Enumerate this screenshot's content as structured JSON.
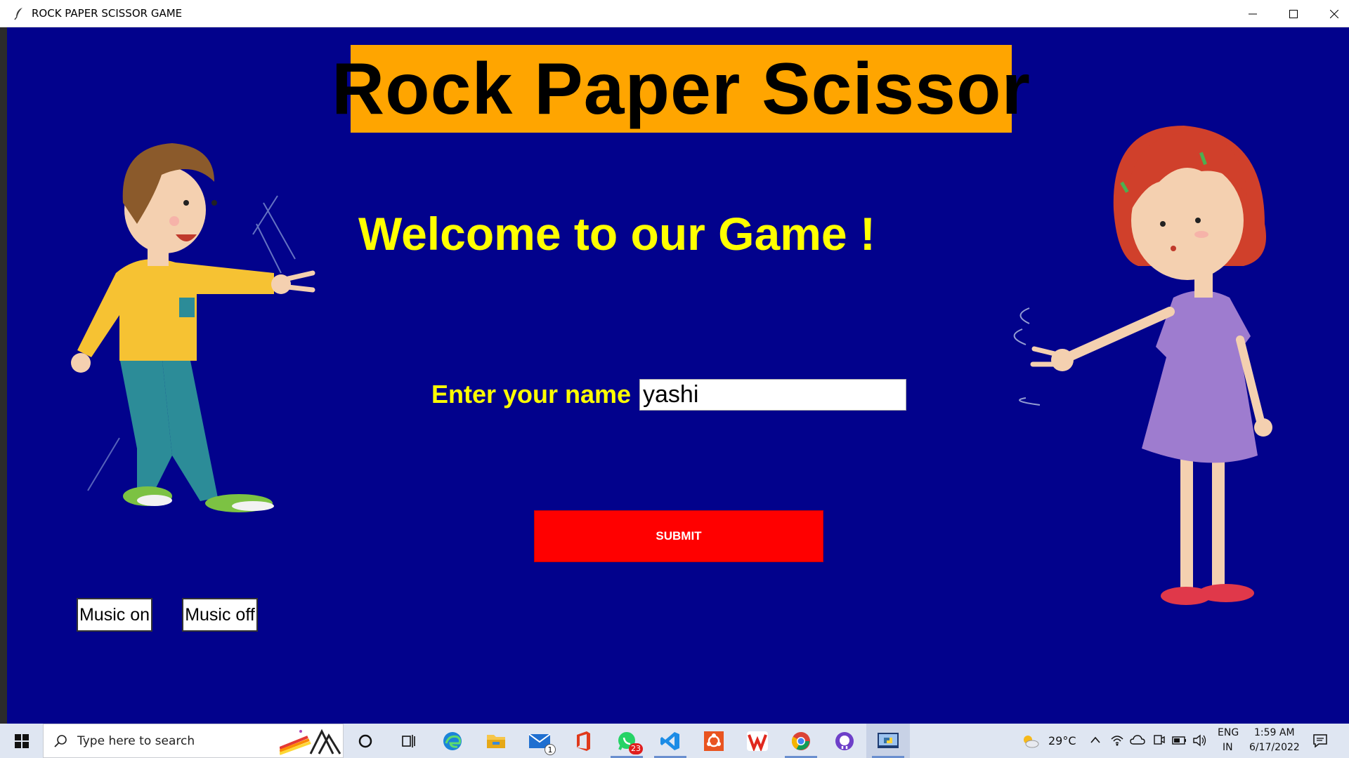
{
  "window": {
    "title": "ROCK PAPER SCISSOR GAME",
    "minimize_icon": "minimize-icon",
    "maximize_icon": "maximize-icon",
    "close_icon": "close-icon"
  },
  "game": {
    "background": "#02028c",
    "heading": "Rock Paper Scissor",
    "heading_bg": "#ffa500",
    "welcome": "Welcome to our Game !",
    "name_label": "Enter your name",
    "name_value": "yashi",
    "submit_label": "SUBMIT",
    "submit_color": "#ff0000",
    "music_on_label": "Music on",
    "music_off_label": "Music off",
    "accent_text_color": "#ffff00"
  },
  "taskbar": {
    "search_placeholder": "Type here to search",
    "pinned": [
      {
        "icon": "cortana-icon"
      },
      {
        "icon": "task-view-icon"
      },
      {
        "icon": "edge-icon"
      },
      {
        "icon": "file-explorer-icon"
      },
      {
        "icon": "mail-icon",
        "badge": "1"
      },
      {
        "icon": "office-icon"
      },
      {
        "icon": "whatsapp-icon",
        "badge": "23"
      },
      {
        "icon": "vscode-icon"
      },
      {
        "icon": "ubuntu-icon"
      },
      {
        "icon": "wps-icon"
      },
      {
        "icon": "chrome-icon"
      },
      {
        "icon": "github-desktop-icon"
      },
      {
        "icon": "python-idle-icon"
      }
    ],
    "weather": "29°C",
    "language_top": "ENG",
    "language_bottom": "IN",
    "time": "1:59 AM",
    "date": "6/17/2022"
  }
}
